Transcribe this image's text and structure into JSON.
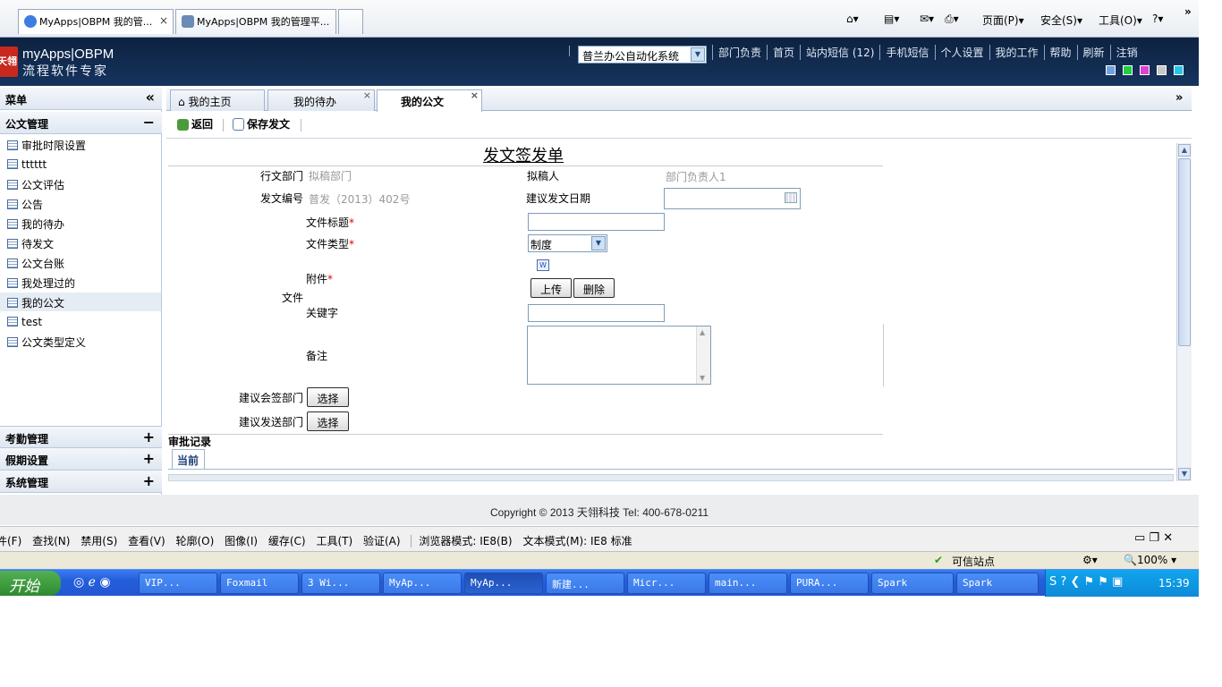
{
  "ie_tabs": [
    {
      "label": "MyApps|OBPM 我的管...",
      "active": true
    },
    {
      "label": "MyApps|OBPM 我的管理平..."
    }
  ],
  "ie_toolbar": {
    "page": "页面(P)",
    "safety": "安全(S)",
    "tools": "工具(O)",
    "more": "»"
  },
  "header": {
    "logo_title": "myApps|OBPM",
    "logo_subtitle": "流程软件专家",
    "logo_mark": "天翎",
    "system_select": "普兰办公自动化系统",
    "links": [
      "部门负责",
      "首页",
      "站内短信 (12)",
      "手机短信",
      "个人设置",
      "我的工作",
      "帮助",
      "刷新",
      "注销"
    ],
    "theme_colors": [
      "#6fa2e0",
      "#22cc44",
      "#e040d0",
      "#c8c8c8",
      "#28c4e8"
    ]
  },
  "sidebar": {
    "title": "菜单",
    "collapse_symbol": "«",
    "group_main": {
      "label": "公文管理",
      "sign": "−"
    },
    "items": [
      "审批时限设置",
      "tttttt",
      "公文评估",
      "公告",
      "我的待办",
      "待发文",
      "公文台账",
      "我处理过的",
      "我的公文",
      "test",
      "公文类型定义"
    ],
    "selected": "我的公文",
    "groups": [
      {
        "label": "考勤管理",
        "sign": "+"
      },
      {
        "label": "假期设置",
        "sign": "+"
      },
      {
        "label": "系统管理",
        "sign": "+"
      }
    ]
  },
  "tabs": {
    "home": "我的主页",
    "todo": "我的待办",
    "mydoc": "我的公文",
    "expand_symbol": "»"
  },
  "toolbar": {
    "back": "返回",
    "save": "保存发文"
  },
  "form": {
    "title": "发文签发单",
    "dept_label": "行文部门",
    "dept_value": "拟稿部门",
    "drafter_label": "拟稿人",
    "drafter_value": "部门负责人1",
    "docno_label": "发文编号",
    "docno_value": "普发（2013）402号",
    "date_label": "建议发文日期",
    "date_value": "",
    "file_group_label": "文件",
    "doc_title_label": "文件标题",
    "doc_title_value": "",
    "doc_type_label": "文件类型",
    "doc_type_value": "制度",
    "attachment_label": "附件",
    "upload_button": "上传",
    "delete_button": "删除",
    "keywords_label": "关键字",
    "keywords_value": "",
    "remarks_label": "备注",
    "remarks_value": "",
    "cosign_label": "建议会签部门",
    "cosign_button": "选择",
    "send_label": "建议发送部门",
    "send_button": "选择",
    "required_mark": "*",
    "approval_title": "审批记录",
    "approval_tab": "当前"
  },
  "footer": {
    "copyright": "Copyright © 2013 天翎科技  Tel: 400-678-0211"
  },
  "devtools": {
    "items": [
      "查找(N)",
      "禁用(S)",
      "查看(V)",
      "轮廓(O)",
      "图像(I)",
      "缓存(C)",
      "工具(T)",
      "验证(A)"
    ],
    "browser_mode": "浏览器模式: IE8(B)",
    "doc_mode": "文本模式(M): IE8 标准"
  },
  "statusbar": {
    "zone": "可信站点",
    "zoom": "100%"
  },
  "taskbar": {
    "start": "开始",
    "tasks": [
      "VIP...",
      "Foxmail",
      "3 Wi...",
      "MyAp...",
      "MyAp...",
      "新建...",
      "Micr...",
      "main...",
      "PURA...",
      "Spark",
      "Spark"
    ],
    "active_task": 4,
    "clock": "15:39"
  }
}
